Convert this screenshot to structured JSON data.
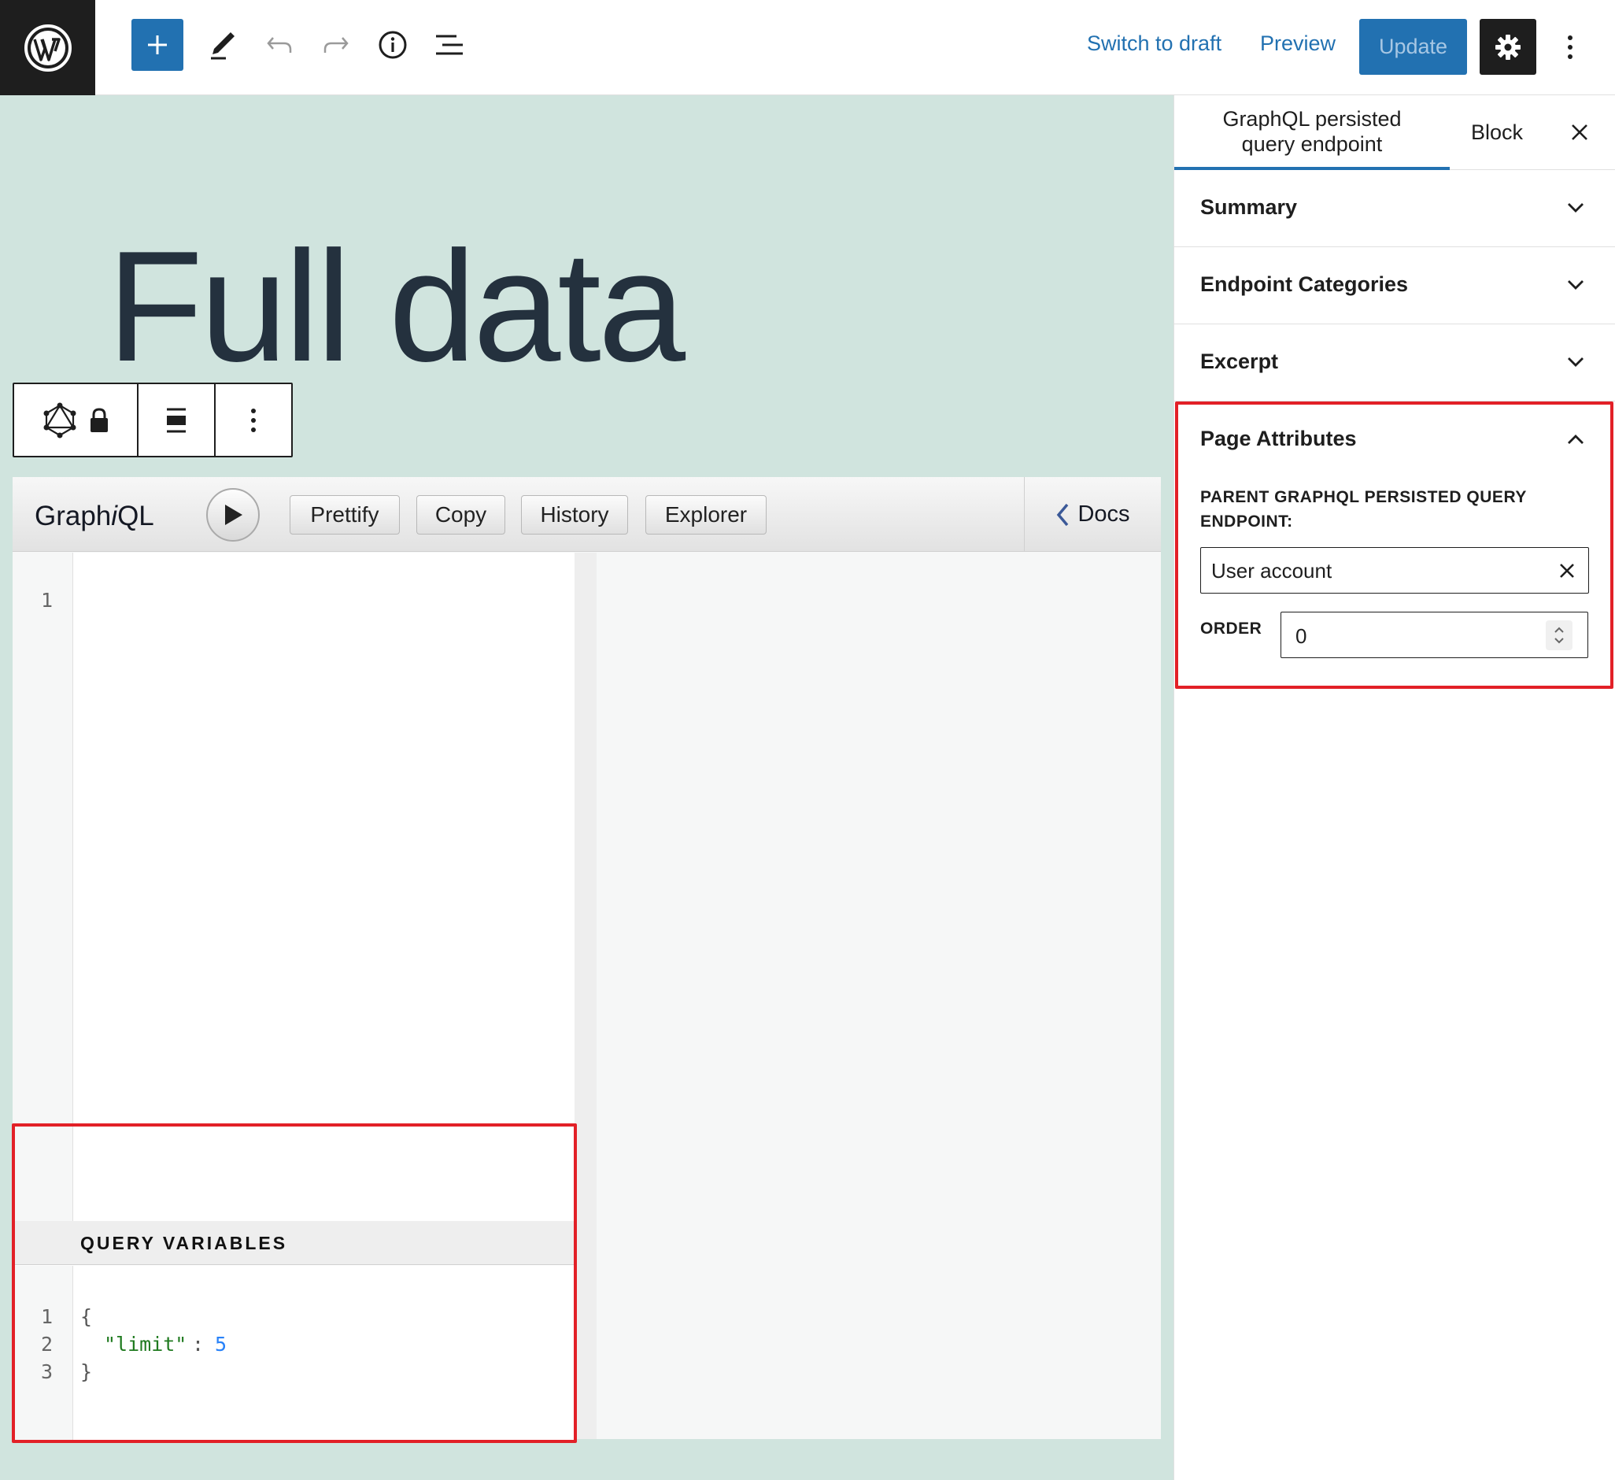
{
  "topbar": {
    "logo_icon": "wordpress-logo-icon",
    "tools": [
      "add-block-icon",
      "pencil-icon",
      "undo-icon",
      "redo-icon",
      "info-icon",
      "list-view-icon"
    ],
    "switch_to_draft": "Switch to draft",
    "preview": "Preview",
    "update": "Update",
    "settings_icon": "gear-icon",
    "more_icon": "vertical-ellipsis-icon"
  },
  "editor": {
    "title": "Full data",
    "block_toolbar": {
      "icons": [
        "graphql-icon",
        "lock-icon",
        "align-icon",
        "vertical-ellipsis-icon"
      ]
    }
  },
  "graphiql": {
    "title_prefix": "Graph",
    "title_italic": "i",
    "title_suffix": "QL",
    "buttons": {
      "prettify": "Prettify",
      "copy": "Copy",
      "history": "History",
      "explorer": "Explorer"
    },
    "docs": "Docs",
    "query_line_numbers": [
      "1"
    ],
    "variables": {
      "header": "QUERY VARIABLES",
      "line_numbers": [
        "1",
        "2",
        "3"
      ],
      "open_brace": "{",
      "key": "\"limit\"",
      "colon": ":",
      "value": "5",
      "close_brace": "}"
    }
  },
  "sidebar": {
    "tab_document_line1": "GraphQL persisted",
    "tab_document_line2": "query endpoint",
    "tab_block": "Block",
    "panels": {
      "summary": "Summary",
      "categories": "Endpoint Categories",
      "excerpt": "Excerpt",
      "attributes": "Page Attributes"
    },
    "parent_label_line1": "PARENT GRAPHQL PERSISTED QUERY",
    "parent_label_line2": "ENDPOINT:",
    "parent_value": "User account",
    "order_label": "ORDER",
    "order_value": "0"
  },
  "colors": {
    "accent": "#2271b1",
    "canvas_bg": "#d0e4de",
    "highlight": "#e22027"
  }
}
